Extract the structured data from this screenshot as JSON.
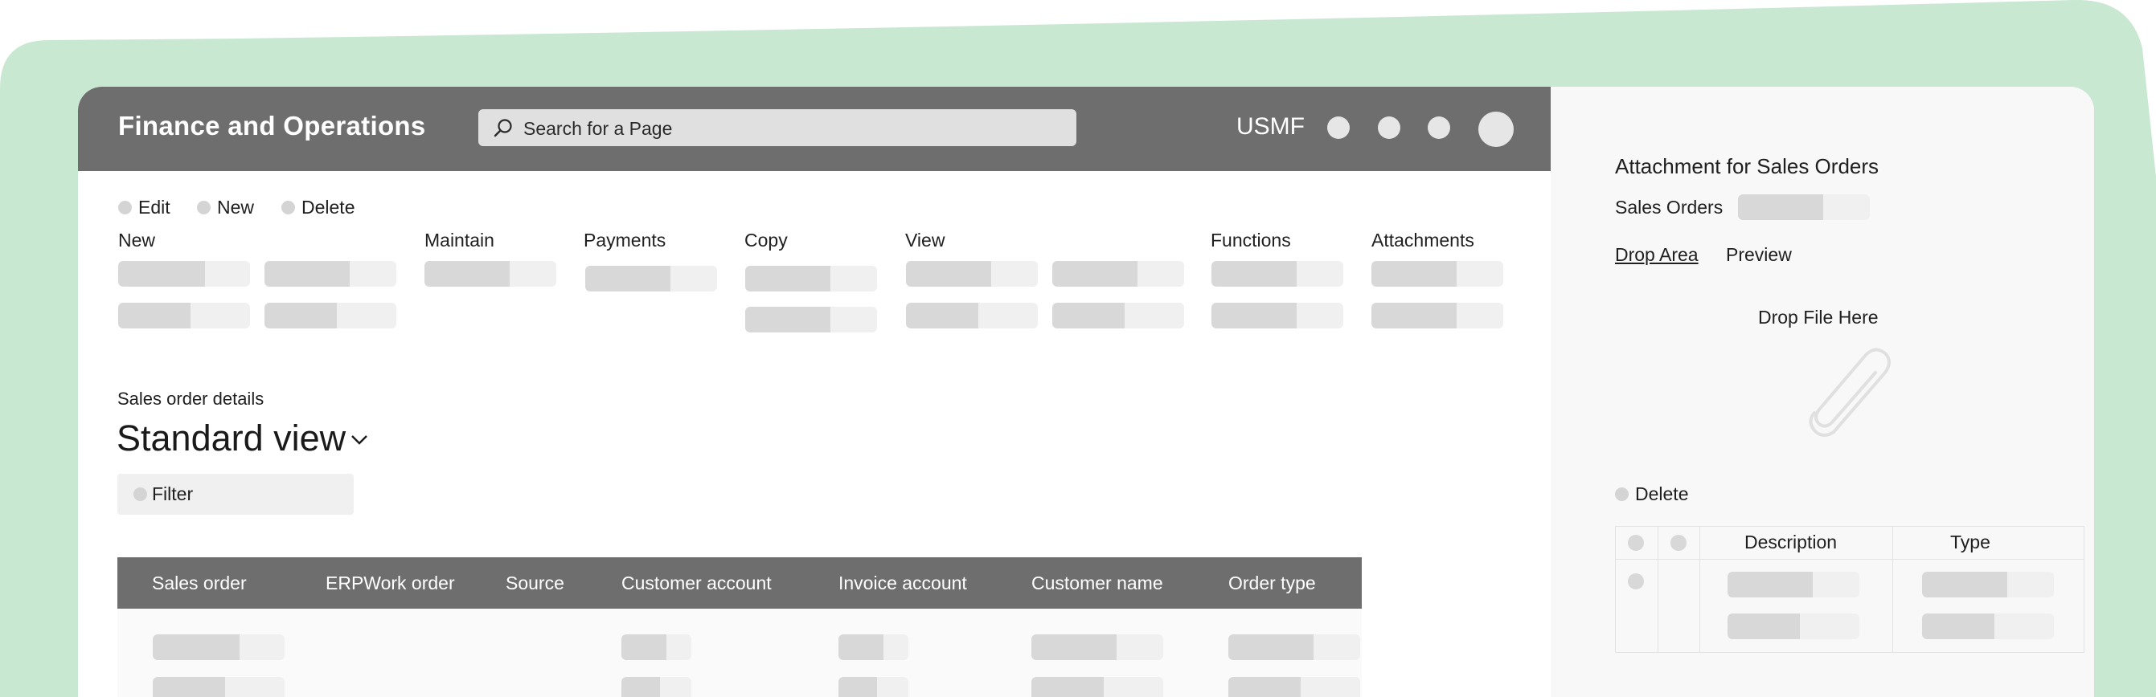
{
  "app": {
    "title": "Finance and Operations",
    "search_placeholder": "Search for a Page",
    "company": "USMF"
  },
  "colors": {
    "header_bg": "#6e6e6e",
    "backdrop_green": "#c8e8d2",
    "placeholder_fill": "#d8d8d8",
    "placeholder_track": "#f0f0f0"
  },
  "actions": [
    {
      "label": "Edit"
    },
    {
      "label": "New"
    },
    {
      "label": "Delete"
    }
  ],
  "ribbon_groups": [
    {
      "label": "New"
    },
    {
      "label": "Maintain"
    },
    {
      "label": "Payments"
    },
    {
      "label": "Copy"
    },
    {
      "label": "View"
    },
    {
      "label": "Functions"
    },
    {
      "label": "Attachments"
    }
  ],
  "page": {
    "section_label": "Sales order details",
    "view_name": "Standard view",
    "filter_label": "Filter"
  },
  "table": {
    "columns": [
      "Sales order",
      "ERPWork order",
      "Source",
      "Customer account",
      "Invoice account",
      "Customer name",
      "Order type"
    ]
  },
  "attachments_pane": {
    "title": "Attachment for Sales Orders",
    "sales_orders_label": "Sales Orders",
    "tab_drop_area": "Drop Area",
    "tab_preview": "Preview",
    "drop_text": "Drop File Here",
    "delete_label": "Delete",
    "columns": [
      "Description",
      "Type"
    ]
  },
  "icons": {
    "search": "search-icon",
    "chevron": "chevron-down-icon",
    "paperclip": "paperclip-icon"
  }
}
